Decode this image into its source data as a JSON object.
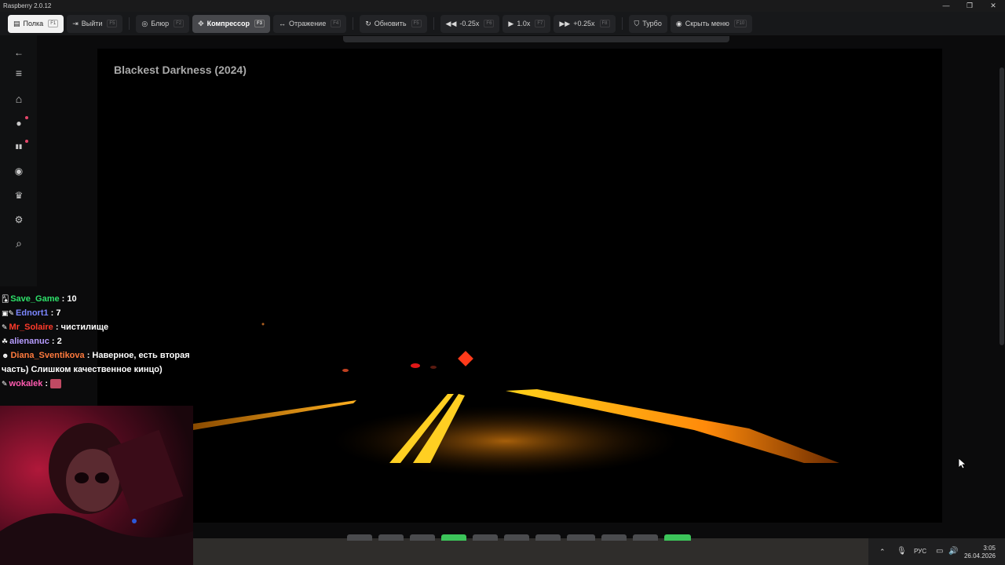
{
  "window": {
    "title": "Raspberry 2.0.12",
    "controls": [
      "—",
      "❐",
      "✕"
    ]
  },
  "toolbar": {
    "buttons": [
      {
        "icon": "shelf-icon",
        "glyph": "▤",
        "label": "Полка",
        "key": "F1"
      },
      {
        "icon": "exit-icon",
        "glyph": "⇥",
        "label": "Выйти",
        "key": "F5"
      },
      {
        "icon": "blur-icon",
        "glyph": "◎",
        "label": "Блюр",
        "key": "F2"
      },
      {
        "icon": "compressor-icon",
        "glyph": "✥",
        "label": "Компрессор",
        "key": "F3"
      },
      {
        "icon": "mirror-icon",
        "glyph": "↔",
        "label": "Отражение",
        "key": "F4"
      },
      {
        "icon": "refresh-icon",
        "glyph": "↻",
        "label": "Обновить",
        "key": "F5"
      },
      {
        "icon": "rewind-icon",
        "glyph": "◀◀",
        "label": "-0.25x",
        "key": "F6"
      },
      {
        "icon": "play-icon",
        "glyph": "▶",
        "label": "1.0x",
        "key": "F7"
      },
      {
        "icon": "fast-forward-icon",
        "glyph": "▶▶",
        "label": "+0.25x",
        "key": "F8"
      },
      {
        "icon": "shield-icon",
        "glyph": "⛉",
        "label": "Турбо",
        "key": ""
      },
      {
        "icon": "eye-icon",
        "glyph": "◉",
        "label": "Скрыть меню",
        "key": "F10"
      }
    ]
  },
  "sidebar": {
    "items": [
      {
        "name": "back-arrow-icon",
        "glyph": "←",
        "dot": false
      },
      {
        "name": "menu-icon",
        "glyph": "≡",
        "dot": false
      },
      {
        "name": "home-icon",
        "glyph": "⌂",
        "dot": false
      },
      {
        "name": "fire-icon",
        "glyph": "●",
        "dot": true
      },
      {
        "name": "book-icon",
        "glyph": "▮▮",
        "dot": true
      },
      {
        "name": "compass-icon",
        "glyph": "◉",
        "dot": false
      },
      {
        "name": "trophy-icon",
        "glyph": "♛",
        "dot": false
      },
      {
        "name": "gear-icon",
        "glyph": "⚙",
        "dot": false
      },
      {
        "name": "search-icon",
        "glyph": "⌕",
        "dot": false
      }
    ]
  },
  "player": {
    "title": "Blackest Darkness (2024)"
  },
  "chat": {
    "messages": [
      {
        "badge": "🂡",
        "user": "Save_Game",
        "color": "#2ee06a",
        "text": "10"
      },
      {
        "badge": "▣✎",
        "user": "Ednort1",
        "color": "#7b86ff",
        "text": "7"
      },
      {
        "badge": "✎",
        "user": "Mr_Solaire",
        "color": "#ff3a2a",
        "text": "чистилище"
      },
      {
        "badge": "☘",
        "user": "alienanuc",
        "color": "#b79cff",
        "text": "2"
      },
      {
        "badge": "☻",
        "user": "Diana_Sventikova",
        "color": "#ff7a3d",
        "text": "Наверное, есть вторая часть) Слишком качественное кинцо)"
      },
      {
        "badge": "✎",
        "user": "wokalek",
        "color": "#ff5bb0",
        "text": ""
      }
    ]
  },
  "taskbar": {
    "language": "РУС",
    "time": "3:05",
    "date": "26.04.2026"
  },
  "colors": {
    "accent_green": "#3cc45a",
    "toolbar_bg": "#17181a"
  }
}
